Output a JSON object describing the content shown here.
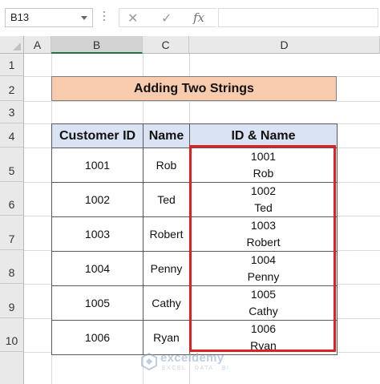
{
  "formula_bar": {
    "name_box": "B13",
    "cancel_icon": "✕",
    "enter_icon": "✓",
    "fx_label": "fx",
    "formula": ""
  },
  "columns": [
    "A",
    "B",
    "C",
    "D"
  ],
  "rows": [
    "1",
    "2",
    "3",
    "4",
    "5",
    "6",
    "7",
    "8",
    "9",
    "10"
  ],
  "title": "Adding Two Strings",
  "table": {
    "headers": [
      "Customer ID",
      "Name",
      "ID & Name"
    ],
    "rows": [
      {
        "id": "1001",
        "name": "Rob",
        "combined_id": "1001",
        "combined_name": "Rob"
      },
      {
        "id": "1002",
        "name": "Ted",
        "combined_id": "1002",
        "combined_name": "Ted"
      },
      {
        "id": "1003",
        "name": "Robert",
        "combined_id": "1003",
        "combined_name": "Robert"
      },
      {
        "id": "1004",
        "name": "Penny",
        "combined_id": "1004",
        "combined_name": "Penny"
      },
      {
        "id": "1005",
        "name": "Cathy",
        "combined_id": "1005",
        "combined_name": "Cathy"
      },
      {
        "id": "1006",
        "name": "Ryan",
        "combined_id": "1006",
        "combined_name": "Ryan"
      }
    ]
  },
  "watermark": {
    "name": "exceldemy",
    "tagline": "EXCEL · DATA · BI"
  },
  "colors": {
    "title_fill": "#f8cbad",
    "header_fill": "#dae3f3",
    "highlight": "#e02020",
    "excel_green": "#217346"
  }
}
